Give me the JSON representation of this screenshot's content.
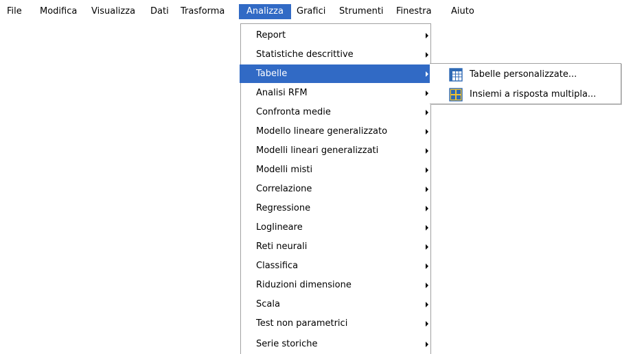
{
  "menubar": {
    "items": [
      {
        "label": "File"
      },
      {
        "label": "Modifica"
      },
      {
        "label": "Visualizza"
      },
      {
        "label": "Dati"
      },
      {
        "label": "Trasforma"
      },
      {
        "label": "Analizza",
        "active": true
      },
      {
        "label": "Grafici"
      },
      {
        "label": "Strumenti"
      },
      {
        "label": "Finestra"
      },
      {
        "label": "Aiuto"
      }
    ]
  },
  "analizza_menu": {
    "items": [
      {
        "label": "Report",
        "has_submenu": true
      },
      {
        "label": "Statistiche descrittive",
        "has_submenu": true
      },
      {
        "label": "Tabelle",
        "has_submenu": true,
        "highlighted": true
      },
      {
        "label": "Analisi RFM",
        "has_submenu": true
      },
      {
        "label": "Confronta medie",
        "has_submenu": true
      },
      {
        "label": "Modello lineare generalizzato",
        "has_submenu": true
      },
      {
        "label": "Modelli lineari generalizzati",
        "has_submenu": true
      },
      {
        "label": "Modelli misti",
        "has_submenu": true
      },
      {
        "label": "Correlazione",
        "has_submenu": true
      },
      {
        "label": "Regressione",
        "has_submenu": true
      },
      {
        "label": "Loglineare",
        "has_submenu": true
      },
      {
        "label": "Reti neurali",
        "has_submenu": true
      },
      {
        "label": "Classifica",
        "has_submenu": true
      },
      {
        "label": "Riduzioni dimensione",
        "has_submenu": true
      },
      {
        "label": "Scala",
        "has_submenu": true
      },
      {
        "label": "Test non parametrici",
        "has_submenu": true
      },
      {
        "label": "Serie storiche",
        "has_submenu": true
      }
    ]
  },
  "tabelle_submenu": {
    "items": [
      {
        "label": "Tabelle personalizzate...",
        "icon": "custom-tables-icon"
      },
      {
        "label": "Insiemi a risposta multipla...",
        "icon": "multiple-response-sets-icon"
      }
    ]
  },
  "colors": {
    "highlight": "#316ac5",
    "highlight_text": "#ffffff",
    "menu_border": "#a0a0a0",
    "icon_blue": "#2f6ab5",
    "icon_yellow": "#f2c230"
  }
}
